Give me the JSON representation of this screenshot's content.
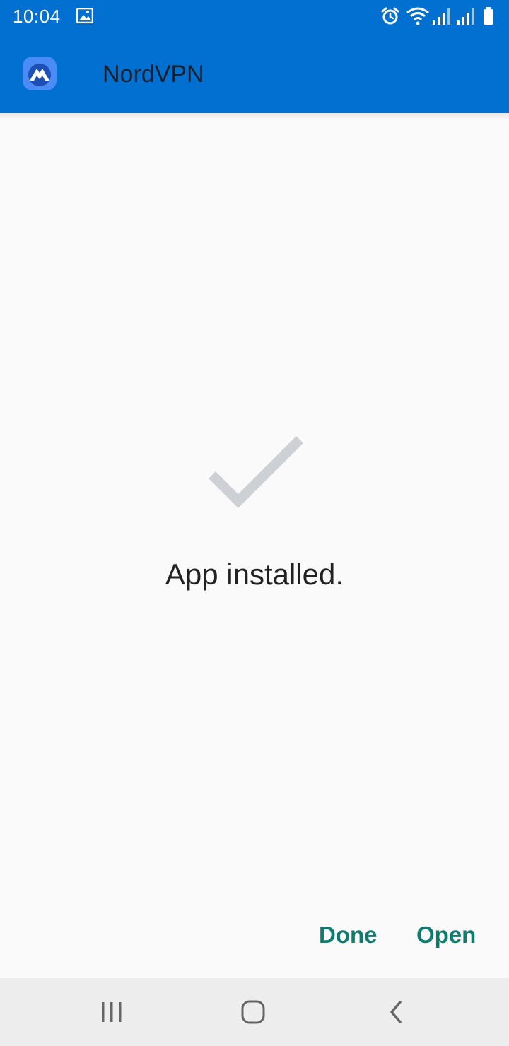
{
  "status_bar": {
    "time": "10:04",
    "icons": [
      "gallery-icon",
      "alarm-icon",
      "wifi-icon",
      "signal-icon",
      "signal-icon",
      "battery-icon"
    ]
  },
  "app_bar": {
    "title": "NordVPN",
    "icon": "nordvpn-app-icon"
  },
  "content": {
    "icon": "checkmark-icon",
    "message": "App installed."
  },
  "actions": {
    "done_label": "Done",
    "open_label": "Open"
  },
  "nav": [
    "recents-icon",
    "home-icon",
    "back-icon"
  ],
  "colors": {
    "primary": "#0270d0",
    "action_text": "#0d7b6e",
    "background": "#fafafa",
    "checkmark": "#cdd0d4",
    "nav_background": "#ededed"
  }
}
